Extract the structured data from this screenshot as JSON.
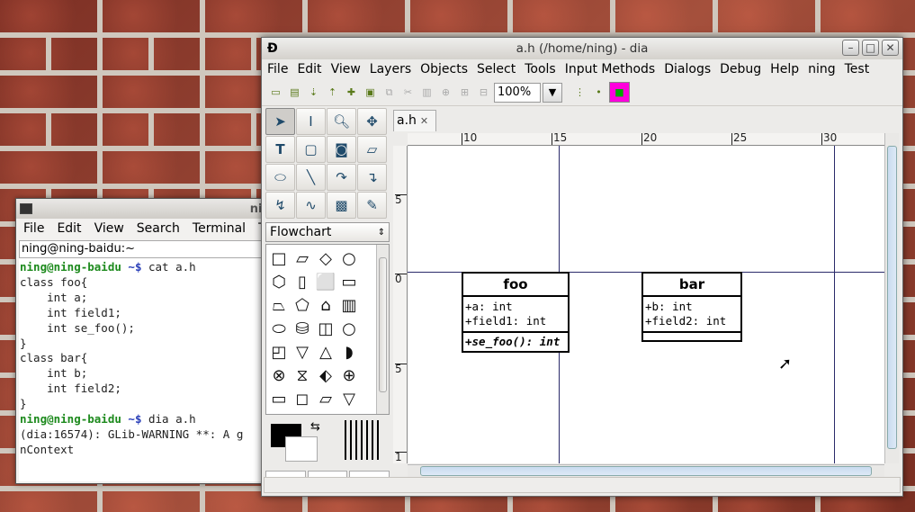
{
  "terminal": {
    "title": "ning",
    "menu": [
      "File",
      "Edit",
      "View",
      "Search",
      "Terminal",
      "Ta"
    ],
    "tab_label": "ning@ning-baidu:~",
    "lines": [
      {
        "prompt": "ning@ning-baidu",
        "path": " ~$",
        "cmd": " cat a.h"
      },
      {
        "text": "class foo{"
      },
      {
        "text": "    int a;"
      },
      {
        "text": "    int field1;"
      },
      {
        "text": "    int se_foo();"
      },
      {
        "text": "}"
      },
      {
        "text": "class bar{"
      },
      {
        "text": "    int b;"
      },
      {
        "text": "    int field2;"
      },
      {
        "text": "}"
      },
      {
        "prompt": "ning@ning-baidu",
        "path": " ~$",
        "cmd": " dia a.h"
      },
      {
        "text": ""
      },
      {
        "text": "(dia:16574): GLib-WARNING **: A g"
      },
      {
        "text": "nContext"
      }
    ]
  },
  "dia": {
    "title": "a.h (/home/ning) - dia",
    "menu": [
      "File",
      "Edit",
      "View",
      "Layers",
      "Objects",
      "Select",
      "Tools",
      "Input Methods",
      "Dialogs",
      "Debug",
      "Help",
      "ning",
      "Test"
    ],
    "zoom": "100%",
    "sheet": "Flowchart",
    "doc_tab": "a.h",
    "ruler_top": [
      "10",
      "15",
      "20",
      "25",
      "30"
    ],
    "ruler_left": [
      "5",
      "0",
      "5",
      "1"
    ],
    "classes": [
      {
        "name": "foo",
        "attributes": [
          "+a: int",
          "+field1: int"
        ],
        "operations": [
          "+se_foo(): int"
        ]
      },
      {
        "name": "bar",
        "attributes": [
          "+b: int",
          "+field2: int"
        ],
        "operations": []
      }
    ]
  }
}
